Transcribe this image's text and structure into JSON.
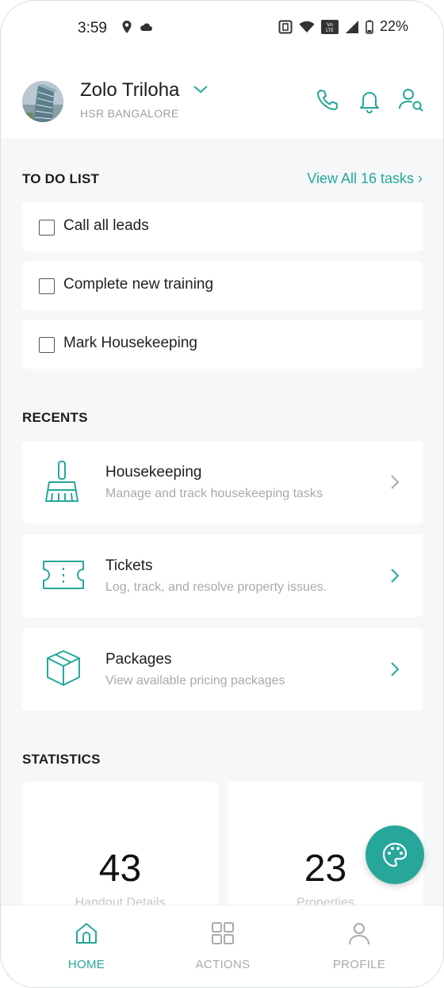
{
  "status_bar": {
    "time": "3:59",
    "battery": "22%"
  },
  "header": {
    "user_name": "Zolo Triloha",
    "location": "HSR BANGALORE",
    "icons": [
      "phone-icon",
      "bell-icon",
      "user-search-icon"
    ]
  },
  "todo": {
    "title": "TO DO LIST",
    "view_all": "View All 16 tasks ›",
    "items": [
      {
        "label": "Call all leads",
        "checked": false
      },
      {
        "label": "Complete new training",
        "checked": false
      },
      {
        "label": "Mark Housekeeping",
        "checked": false
      }
    ]
  },
  "recents": {
    "title": "RECENTS",
    "items": [
      {
        "title": "Housekeeping",
        "subtitle": "Manage and track housekeeping tasks",
        "icon": "broom-icon"
      },
      {
        "title": "Tickets",
        "subtitle": "Log, track, and resolve property issues.",
        "icon": "ticket-icon"
      },
      {
        "title": "Packages",
        "subtitle": "View available pricing packages",
        "icon": "package-box-icon"
      }
    ]
  },
  "statistics": {
    "title": "STATISTICS",
    "cards": [
      {
        "value": "43",
        "label": "Handout Details"
      },
      {
        "value": "23",
        "label": "Properties"
      }
    ]
  },
  "bottom_nav": {
    "items": [
      {
        "label": "HOME",
        "active": true
      },
      {
        "label": "ACTIONS",
        "active": false
      },
      {
        "label": "PROFILE",
        "active": false
      }
    ]
  },
  "colors": {
    "accent": "#26a79a",
    "background": "#f5f7f8"
  }
}
